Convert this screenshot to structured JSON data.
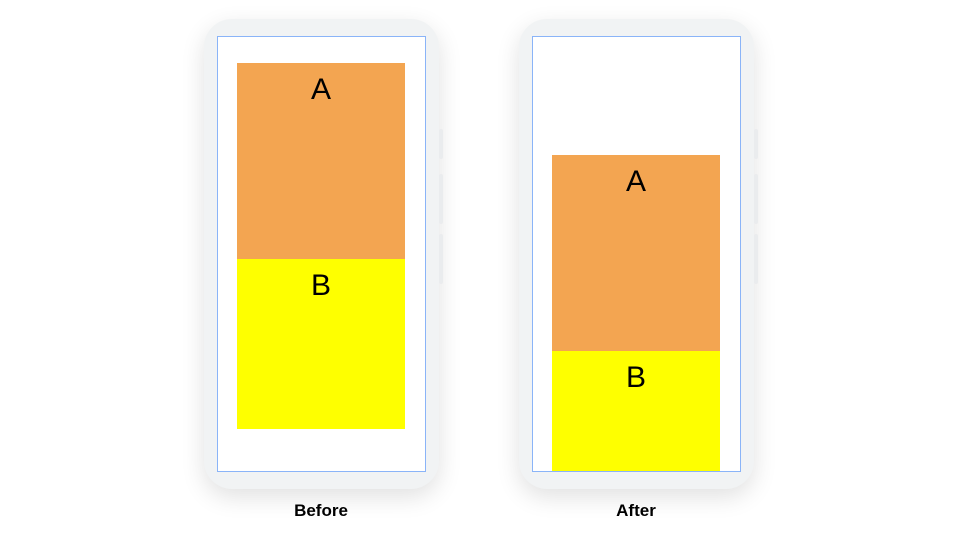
{
  "diagram": {
    "before": {
      "caption": "Before",
      "boxA": {
        "label": "A",
        "color": "#f3a551"
      },
      "boxB": {
        "label": "B",
        "color": "#feff00"
      }
    },
    "after": {
      "caption": "After",
      "boxA": {
        "label": "A",
        "color": "#f3a551"
      },
      "boxB": {
        "label": "B",
        "color": "#feff00"
      }
    }
  }
}
